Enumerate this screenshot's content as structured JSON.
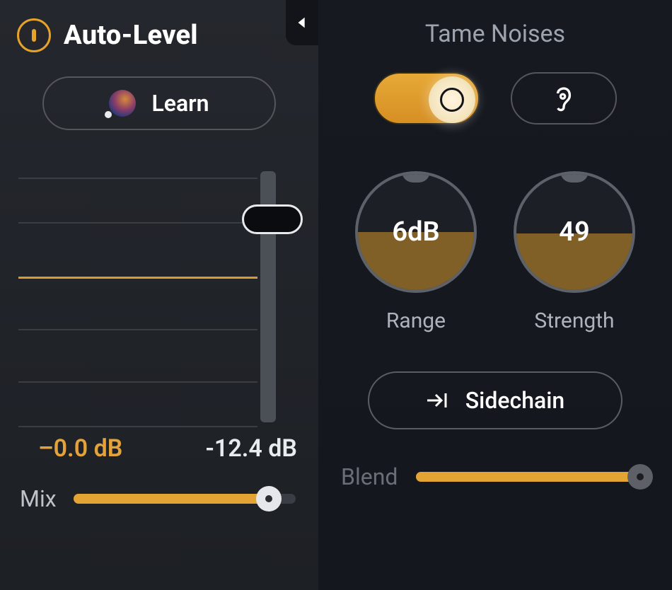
{
  "left": {
    "title": "Auto-Level",
    "learn_label": "Learn",
    "slider_position_pct": 20,
    "gridlines_pct": [
      4,
      21,
      42,
      62,
      82,
      99
    ],
    "bold_line_index": 2,
    "readout_left": "–0.0 dB",
    "readout_right": "-12.4 dB",
    "mix_label": "Mix",
    "mix_value_pct": 88
  },
  "right": {
    "title": "Tame Noises",
    "toggle_on": true,
    "dials": [
      {
        "value": "6dB",
        "label": "Range",
        "fill_pct": 50
      },
      {
        "value": "49",
        "label": "Strength",
        "fill_pct": 49
      }
    ],
    "sidechain_label": "Sidechain",
    "blend_label": "Blend",
    "blend_value_pct": 96
  },
  "colors": {
    "accent": "#e3a433"
  }
}
